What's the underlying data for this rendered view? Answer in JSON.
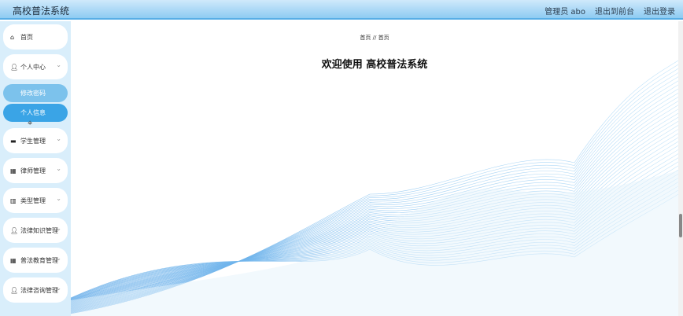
{
  "header": {
    "title": "高校普法系统",
    "user_label": "管理员 abo",
    "front_link": "退出到前台",
    "logout_link": "退出登录"
  },
  "sidebar": {
    "items": [
      {
        "label": "首页",
        "icon": "home-icon"
      },
      {
        "label": "个人中心",
        "icon": "user-icon"
      },
      {
        "label": "学生管理",
        "icon": "briefcase-icon"
      },
      {
        "label": "律师管理",
        "icon": "grid-icon"
      },
      {
        "label": "类型管理",
        "icon": "chart-icon"
      },
      {
        "label": "法律知识管理",
        "icon": "user-icon"
      },
      {
        "label": "普法教育管理",
        "icon": "grid-icon"
      },
      {
        "label": "法律咨询管理",
        "icon": "user-icon"
      }
    ],
    "sub_items": [
      "修改密码",
      "个人信息"
    ]
  },
  "main": {
    "breadcrumb_home": "首页",
    "breadcrumb_sep": "//",
    "breadcrumb_current": "首页",
    "welcome": "欢迎使用 高校普法系统"
  },
  "colors": {
    "accent": "#3aa4e6",
    "sidebar_bg": "#d9eefb"
  }
}
